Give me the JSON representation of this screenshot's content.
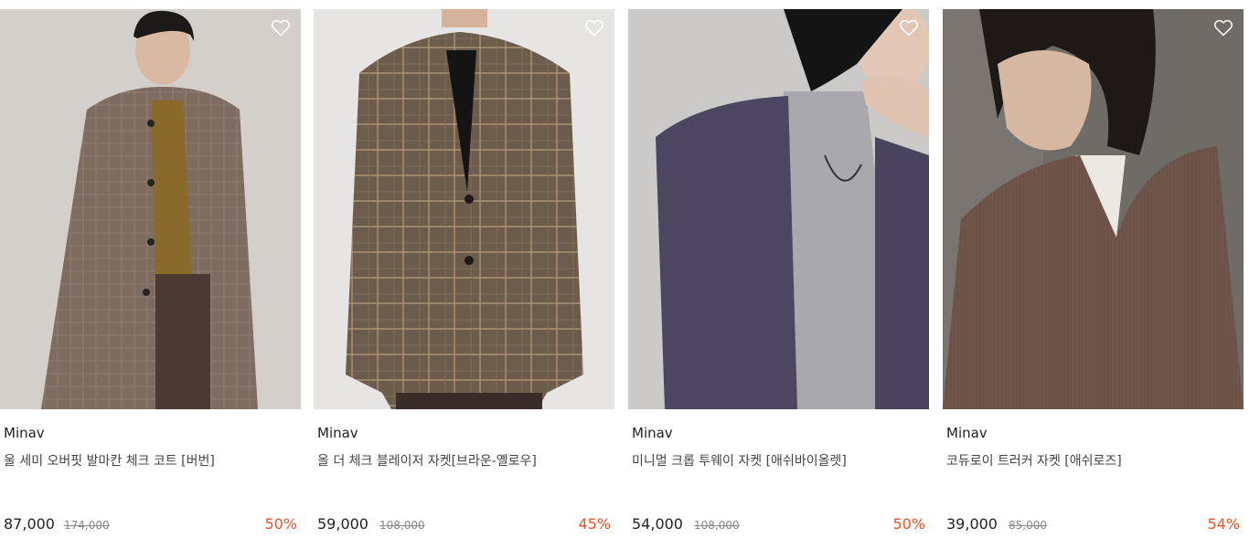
{
  "accent_color": "#e8532b",
  "products": [
    {
      "brand": "Minav",
      "name": "울 세미 오버핏 발마칸 체크 코트 [버번]",
      "price": "87,000",
      "original_price": "174,000",
      "discount": "50%",
      "wishlist_icon": "heart-outline-icon"
    },
    {
      "brand": "Minav",
      "name": "올 더 체크 블레이저 자켓[브라운-옐로우]",
      "price": "59,000",
      "original_price": "108,000",
      "discount": "45%",
      "wishlist_icon": "heart-outline-icon"
    },
    {
      "brand": "Minav",
      "name": "미니멀 크롭 투웨이 자켓 [애쉬바이올렛]",
      "price": "54,000",
      "original_price": "108,000",
      "discount": "50%",
      "wishlist_icon": "heart-outline-icon"
    },
    {
      "brand": "Minav",
      "name": "코듀로이 트러커 자켓 [애쉬로즈]",
      "price": "39,000",
      "original_price": "85,000",
      "discount": "54%",
      "wishlist_icon": "heart-outline-icon"
    }
  ]
}
